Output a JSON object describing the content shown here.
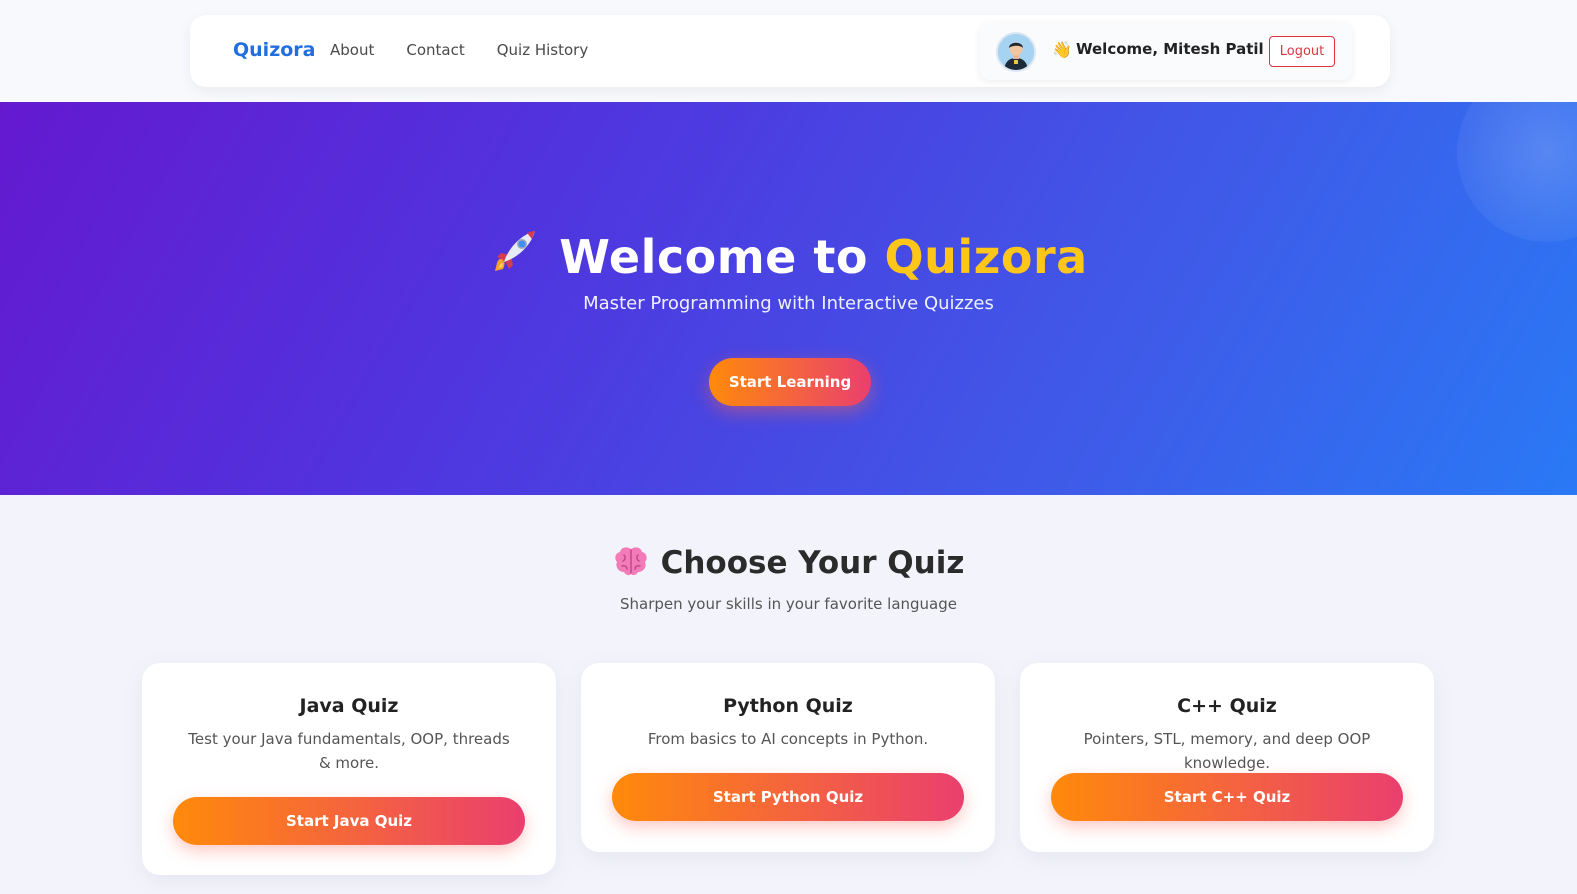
{
  "navbar": {
    "brand": "Quizora",
    "links": [
      "About",
      "Contact",
      "Quiz History"
    ],
    "welcome": "Welcome, Mitesh Patil",
    "logout_label": "Logout"
  },
  "hero": {
    "title_prefix": "Welcome to ",
    "title_accent": "Quizora",
    "subtitle": "Master Programming with Interactive Quizzes",
    "cta_label": "Start Learning"
  },
  "quizzes": {
    "heading": "Choose Your Quiz",
    "subheading": "Sharpen your skills in your favorite language",
    "cards": [
      {
        "title": "Java Quiz",
        "description": "Test your Java fundamentals, OOP, threads & more.",
        "button": "Start Java Quiz"
      },
      {
        "title": "Python Quiz",
        "description": "From basics to AI concepts in Python.",
        "button": "Start Python Quiz"
      },
      {
        "title": "C++ Quiz",
        "description": "Pointers, STL, memory, and deep OOP knowledge.",
        "button": "Start C++ Quiz"
      }
    ]
  },
  "icons": {
    "wave": "waving-hand-icon",
    "rocket": "rocket-icon",
    "brain": "brain-icon",
    "avatar": "user-avatar"
  },
  "colors": {
    "brand": "#1f6fe0",
    "accent": "#ffc61a",
    "button_start": "#ff8a0a",
    "button_end": "#ea3f6f",
    "logout": "#dc3545"
  }
}
